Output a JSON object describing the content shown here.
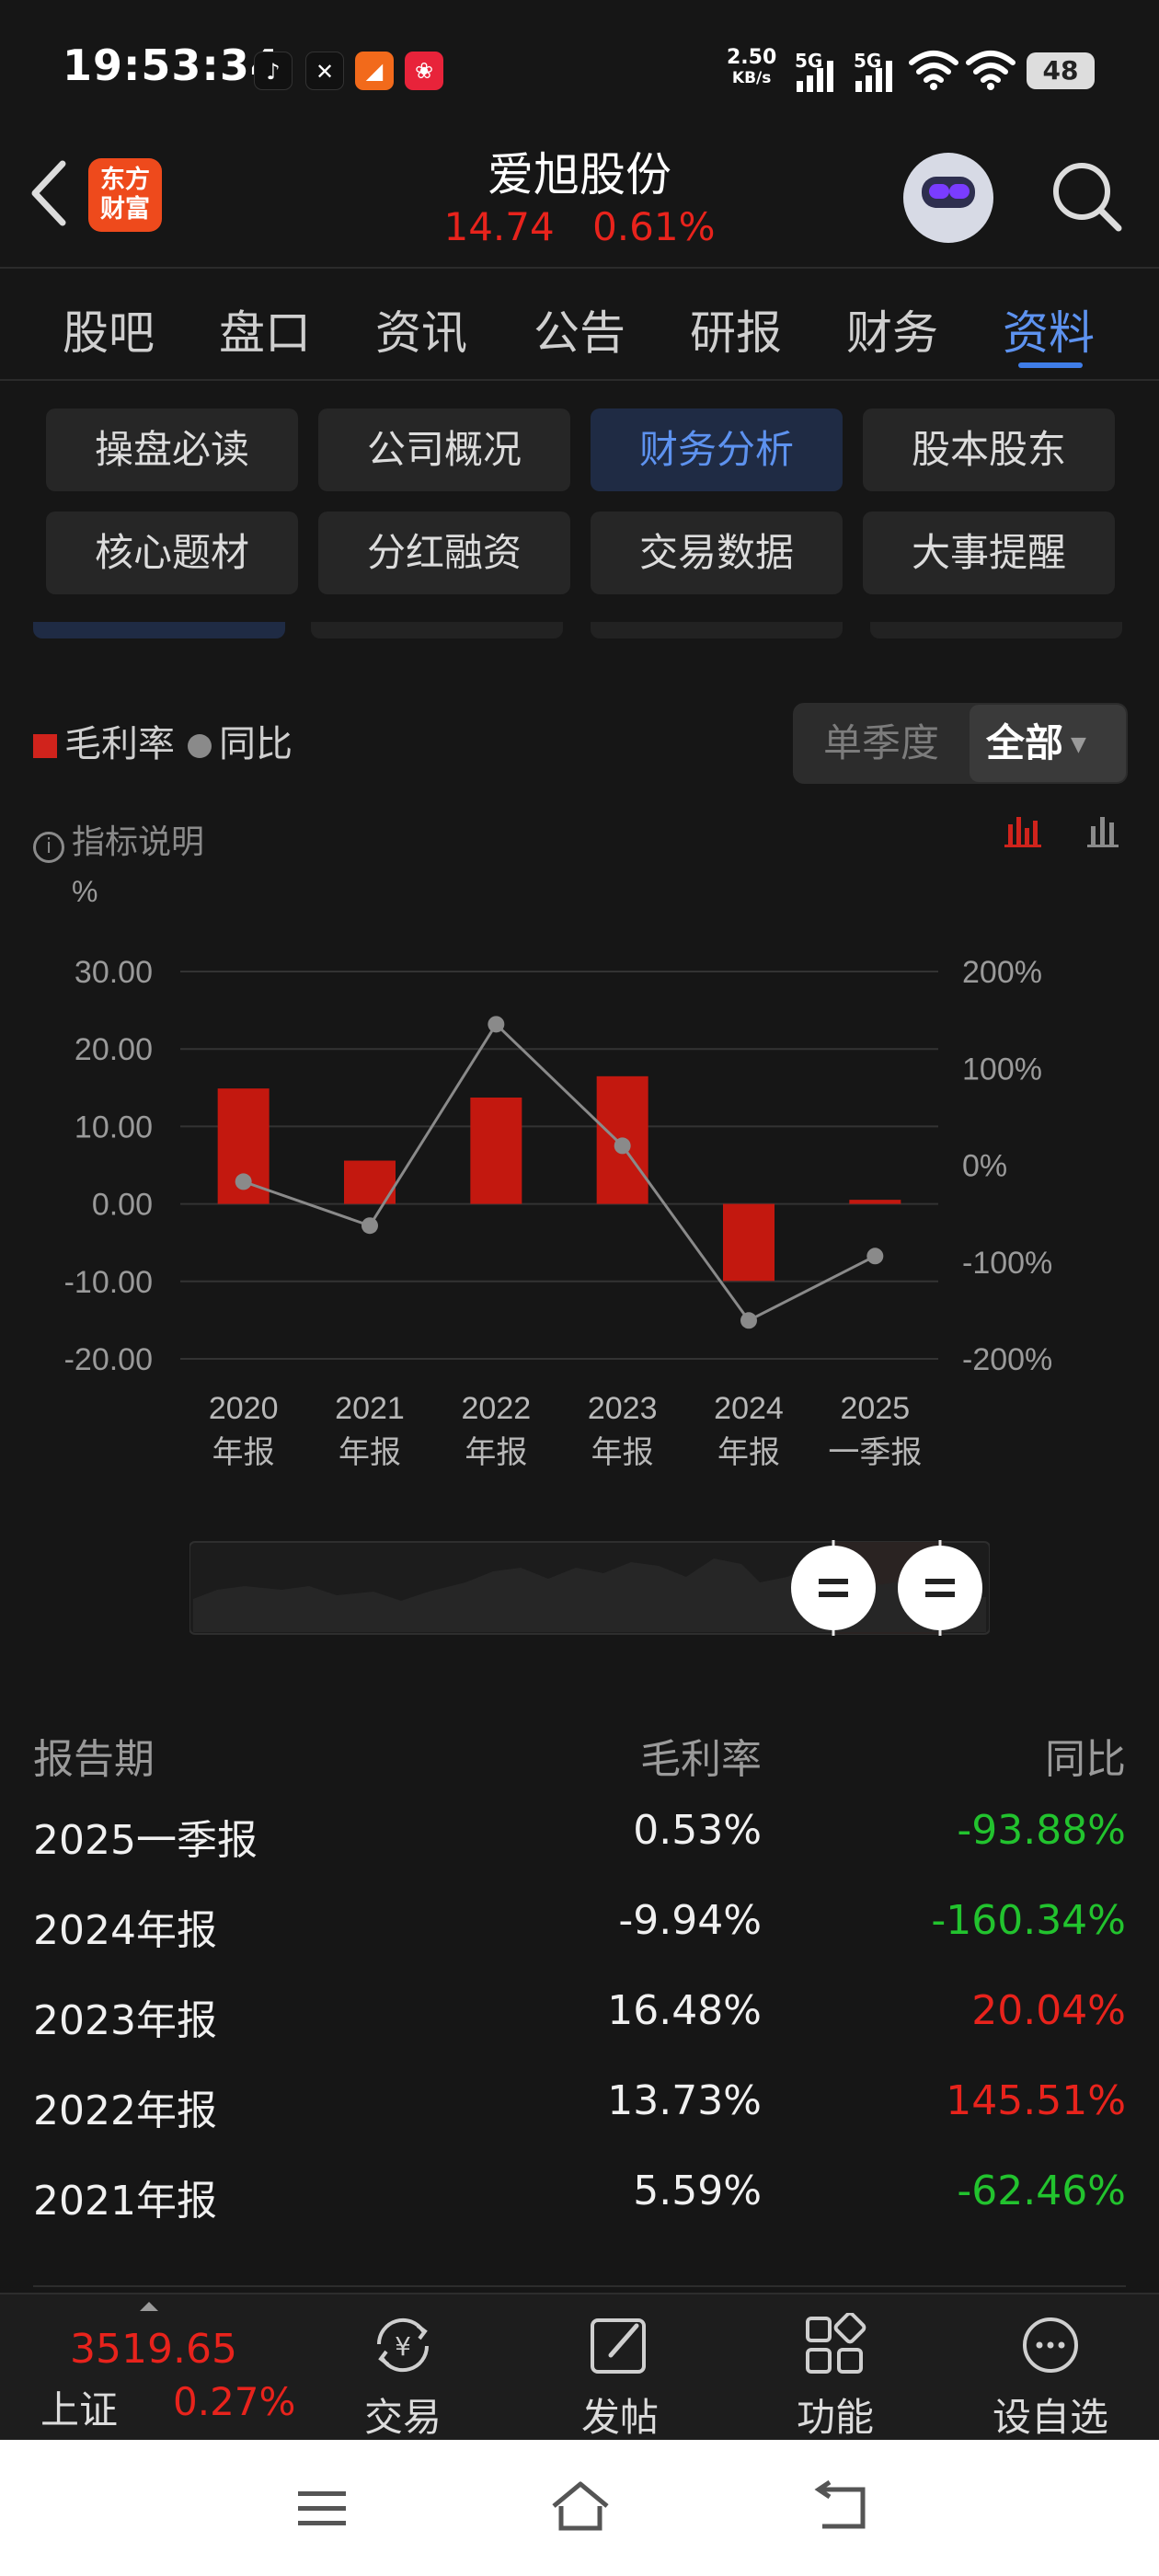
{
  "status_bar": {
    "time": "19:53:34",
    "net_speed_value": "2.50",
    "net_speed_unit": "KB/s",
    "signal1": "5G",
    "signal2": "5G",
    "battery": "48"
  },
  "header": {
    "logo_line1": "东方",
    "logo_line2": "财富",
    "stock_name": "爱旭股份",
    "price": "14.74",
    "change_pct": "0.61%"
  },
  "tabs": [
    "股吧",
    "盘口",
    "资讯",
    "公告",
    "研报",
    "财务",
    "资料"
  ],
  "active_tab": "资料",
  "sub_buttons": [
    "操盘必读",
    "公司概况",
    "财务分析",
    "股本股东",
    "核心题材",
    "分红融资",
    "交易数据",
    "大事提醒"
  ],
  "active_sub_button": "财务分析",
  "legend": {
    "bar": "毛利率",
    "line": "同比"
  },
  "segment": {
    "option1": "单季度",
    "option2": "全部"
  },
  "info_label": "指标说明",
  "chart_data": {
    "type": "bar",
    "unit_label": "%",
    "categories": [
      [
        "2020",
        "年报"
      ],
      [
        "2021",
        "年报"
      ],
      [
        "2022",
        "年报"
      ],
      [
        "2023",
        "年报"
      ],
      [
        "2024",
        "年报"
      ],
      [
        "2025",
        "一季报"
      ]
    ],
    "series": [
      {
        "name": "毛利率",
        "type": "bar",
        "axis": "left",
        "values": [
          14.9,
          5.59,
          13.73,
          16.48,
          -9.94,
          0.53
        ]
      },
      {
        "name": "同比",
        "type": "line",
        "axis": "right",
        "values": [
          -17,
          -62.46,
          145.51,
          20.04,
          -160.34,
          -93.88
        ]
      }
    ],
    "left_ticks": [
      "30.00",
      "20.00",
      "10.00",
      "0.00",
      "-10.00",
      "-20.00"
    ],
    "left_ylim": [
      -20,
      30
    ],
    "right_ticks": [
      "200%",
      "100%",
      "0%",
      "-100%",
      "-200%"
    ],
    "right_ylim": [
      -200,
      200
    ],
    "colors": {
      "bar": "#c3180f",
      "line": "#8a8a8a",
      "grid": "#333333"
    }
  },
  "table": {
    "headers": [
      "报告期",
      "毛利率",
      "同比"
    ],
    "rows": [
      {
        "period": "2025一季报",
        "value": "0.53%",
        "yoy": "-93.88%",
        "trend": "neg"
      },
      {
        "period": "2024年报",
        "value": "-9.94%",
        "yoy": "-160.34%",
        "trend": "neg"
      },
      {
        "period": "2023年报",
        "value": "16.48%",
        "yoy": "20.04%",
        "trend": "pos"
      },
      {
        "period": "2022年报",
        "value": "13.73%",
        "yoy": "145.51%",
        "trend": "pos"
      },
      {
        "period": "2021年报",
        "value": "5.59%",
        "yoy": "-62.46%",
        "trend": "neg"
      }
    ]
  },
  "bottom_nav": {
    "index_value": "3519.65",
    "index_name": "上证",
    "index_change": "0.27%",
    "items": [
      "交易",
      "发帖",
      "功能",
      "设自选"
    ]
  }
}
